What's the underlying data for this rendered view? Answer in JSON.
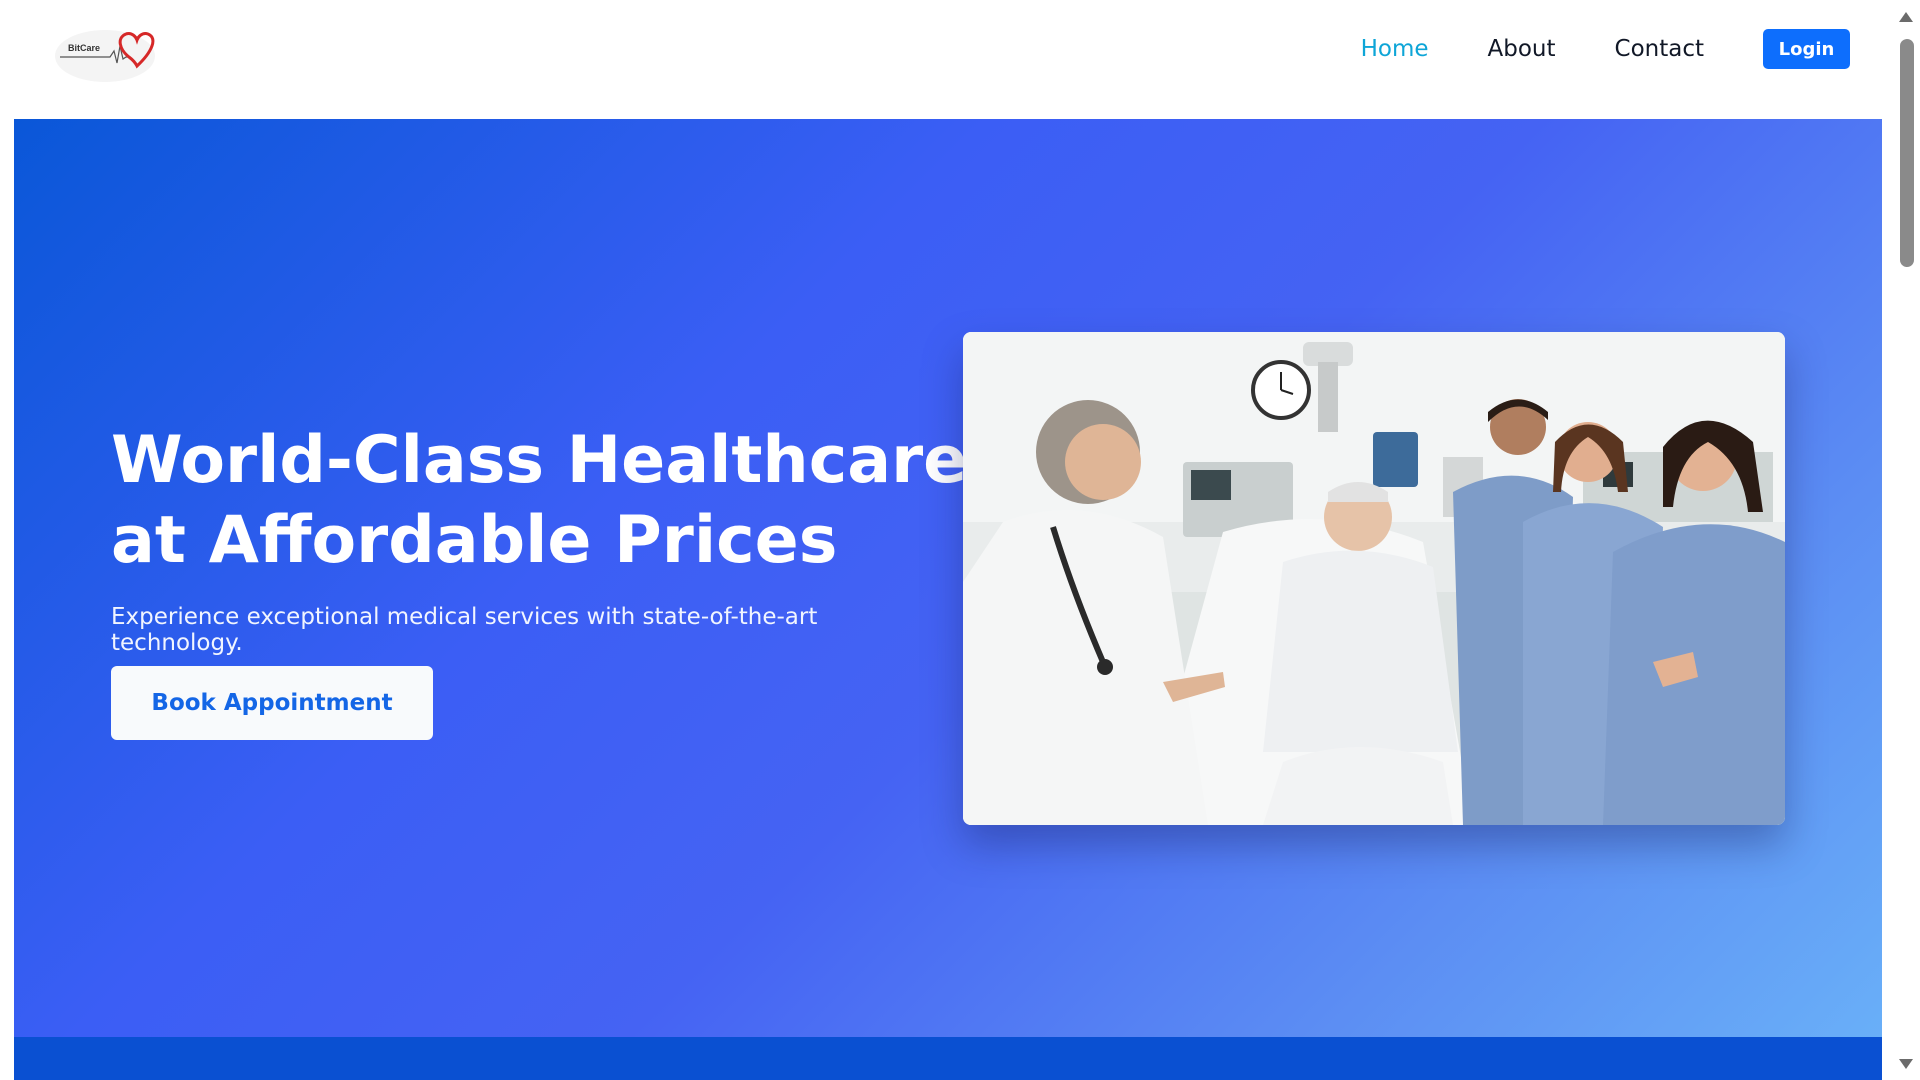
{
  "brand": {
    "name": "BitCare",
    "accent": "#d62828"
  },
  "nav": {
    "links": [
      {
        "label": "Home",
        "active": true
      },
      {
        "label": "About",
        "active": false
      },
      {
        "label": "Contact",
        "active": false
      }
    ],
    "login_label": "Login"
  },
  "hero": {
    "title": "World-Class Healthcare at Affordable Prices",
    "subtitle": "Experience exceptional medical services with state-of-the-art technology.",
    "cta_label": "Book Appointment",
    "image_subject": "doctor-with-patient-and-nurses-photo"
  },
  "colors": {
    "primary": "#0d6efd",
    "nav_active": "#0ea5d7",
    "hero_gradient_start": "#0a57d8",
    "hero_gradient_end": "#69aff8",
    "band": "#0a50d2"
  }
}
